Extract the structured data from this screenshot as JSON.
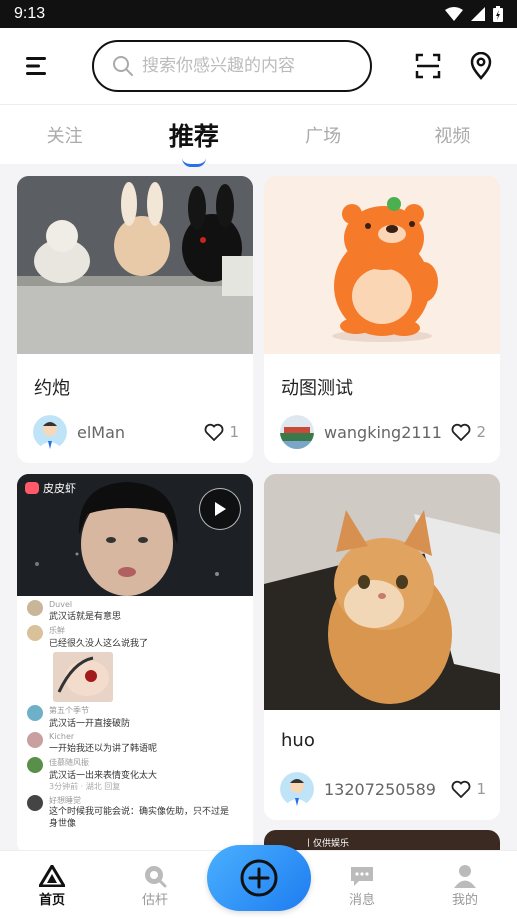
{
  "status": {
    "time": "9:13"
  },
  "search": {
    "placeholder": "搜索你感兴趣的内容"
  },
  "tabs": [
    {
      "label": "关注",
      "active": false
    },
    {
      "label": "推荐",
      "active": true
    },
    {
      "label": "广场",
      "active": false
    },
    {
      "label": "视频",
      "active": false
    }
  ],
  "cards": [
    {
      "title": "约炮",
      "user": "elMan",
      "likes": "1",
      "image": "plush-toys-photo"
    },
    {
      "title": "动图测试",
      "user": "wangking2111",
      "likes": "2",
      "image": "orange-bear-illustration"
    },
    {
      "title": "",
      "user": "",
      "likes": "",
      "image": "video-screenshot",
      "video": true,
      "overlay": {
        "app_tag": "皮皮虾",
        "chat": [
          {
            "name": "Duvel",
            "text": "武汉话就是有意思"
          },
          {
            "name": "乐鲜",
            "text": "已经很久没人这么说我了"
          },
          {
            "name": "第五个季节",
            "text": "武汉话一开直接破防"
          },
          {
            "name": "Kicher",
            "text": "一开始我还以为讲了韩语呢"
          },
          {
            "name": "佳慕随风振",
            "text": "武汉话一出来表情变化太大"
          },
          {
            "name": "",
            "text": "3分钟前 · 湖北     回复"
          },
          {
            "name": "好想睡觉",
            "text": "这个时候我可能会说：确实像佐助，只不过是身世像"
          }
        ]
      }
    },
    {
      "title": "huo",
      "user": "13207250589",
      "likes": "1",
      "image": "orange-cat-photo"
    },
    {
      "title": "",
      "user": "",
      "likes": "",
      "image": "partial-image",
      "overlay_text": "丨仅供娱乐"
    }
  ],
  "bottom_nav": [
    {
      "label": "首页",
      "icon": "home-icon",
      "active": true
    },
    {
      "label": "估杆",
      "icon": "estimate-icon",
      "active": false
    },
    {
      "label": "消息",
      "icon": "message-icon",
      "active": false
    },
    {
      "label": "我的",
      "icon": "profile-icon",
      "active": false
    }
  ],
  "colors": {
    "accent": "#2a6fe8",
    "fab_start": "#4ab0ff",
    "fab_end": "#1e7cf0"
  }
}
